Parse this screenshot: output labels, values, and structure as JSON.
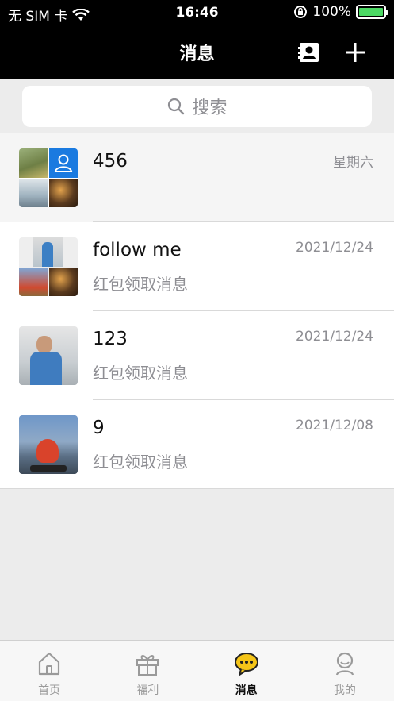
{
  "status_bar": {
    "carrier": "无 SIM 卡",
    "time": "16:46",
    "battery": "100%",
    "battery_level": 1.0
  },
  "nav": {
    "title": "消息"
  },
  "search": {
    "placeholder": "搜索"
  },
  "conversations": [
    {
      "name": "456",
      "date": "星期六",
      "message": ""
    },
    {
      "name": "follow me",
      "date": "2021/12/24",
      "message": "红包领取消息"
    },
    {
      "name": "123",
      "date": "2021/12/24",
      "message": "红包领取消息"
    },
    {
      "name": "9",
      "date": "2021/12/08",
      "message": "红包领取消息"
    }
  ],
  "tabs": [
    {
      "label": "首页",
      "icon": "home-icon"
    },
    {
      "label": "福利",
      "icon": "gift-icon"
    },
    {
      "label": "消息",
      "icon": "chat-bubble-icon"
    },
    {
      "label": "我的",
      "icon": "profile-icon"
    }
  ],
  "colors": {
    "nav_bg": "#000000",
    "battery": "#4cd964",
    "accent": "#f5c518",
    "text_secondary": "#8e8e93"
  }
}
